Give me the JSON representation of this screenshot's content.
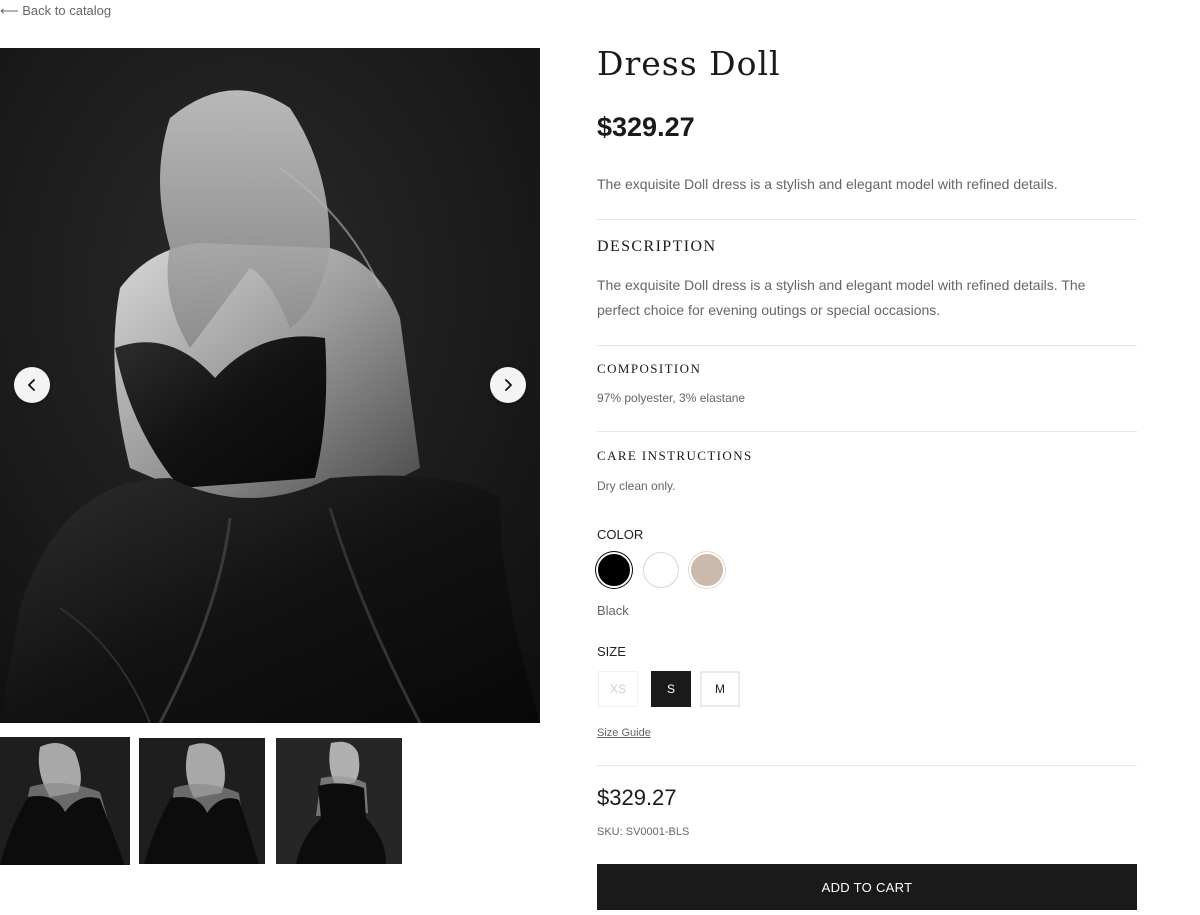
{
  "nav": {
    "back_label": "⟵ Back to catalog"
  },
  "product": {
    "title": "Dress Doll",
    "price": "$329.27",
    "lead": "The exquisite Doll dress is a stylish and elegant model with refined details."
  },
  "sections": {
    "description": {
      "title": "DESCRIPTION",
      "text": "The exquisite Doll dress is a stylish and elegant model with refined details. The perfect choice for evening outings or special occasions."
    },
    "composition": {
      "title": "COMPOSITION",
      "text": "97% polyester, 3% elastane"
    },
    "care": {
      "title": "CARE INSTRUCTIONS",
      "text": "Dry clean only."
    }
  },
  "color": {
    "label": "COLOR",
    "selected_name": "Black",
    "swatches": [
      {
        "name": "Black",
        "hex": "#000000",
        "selected": true
      },
      {
        "name": "White",
        "hex": "#ffffff",
        "selected": false
      },
      {
        "name": "Beige",
        "hex": "#cbb9ab",
        "selected": false
      }
    ]
  },
  "size": {
    "label": "SIZE",
    "options": [
      {
        "label": "XS",
        "state": "unavailable"
      },
      {
        "label": "S",
        "state": "selected"
      },
      {
        "label": "M",
        "state": "available"
      }
    ],
    "guide_label": "Size Guide"
  },
  "purchase": {
    "price": "$329.27",
    "sku": "SKU: SV0001-BLS",
    "add_to_cart_label": "ADD TO CART"
  },
  "gallery": {
    "prev_icon": "chevron-left-icon",
    "next_icon": "chevron-right-icon",
    "thumbnail_count": 3,
    "image_tone": "black-and-white photo of model in black strapless dress"
  },
  "colors": {
    "text": "#1a1a1a",
    "muted": "#666666",
    "button_bg": "#1a1a1a",
    "divider": "#e6e6e6"
  }
}
